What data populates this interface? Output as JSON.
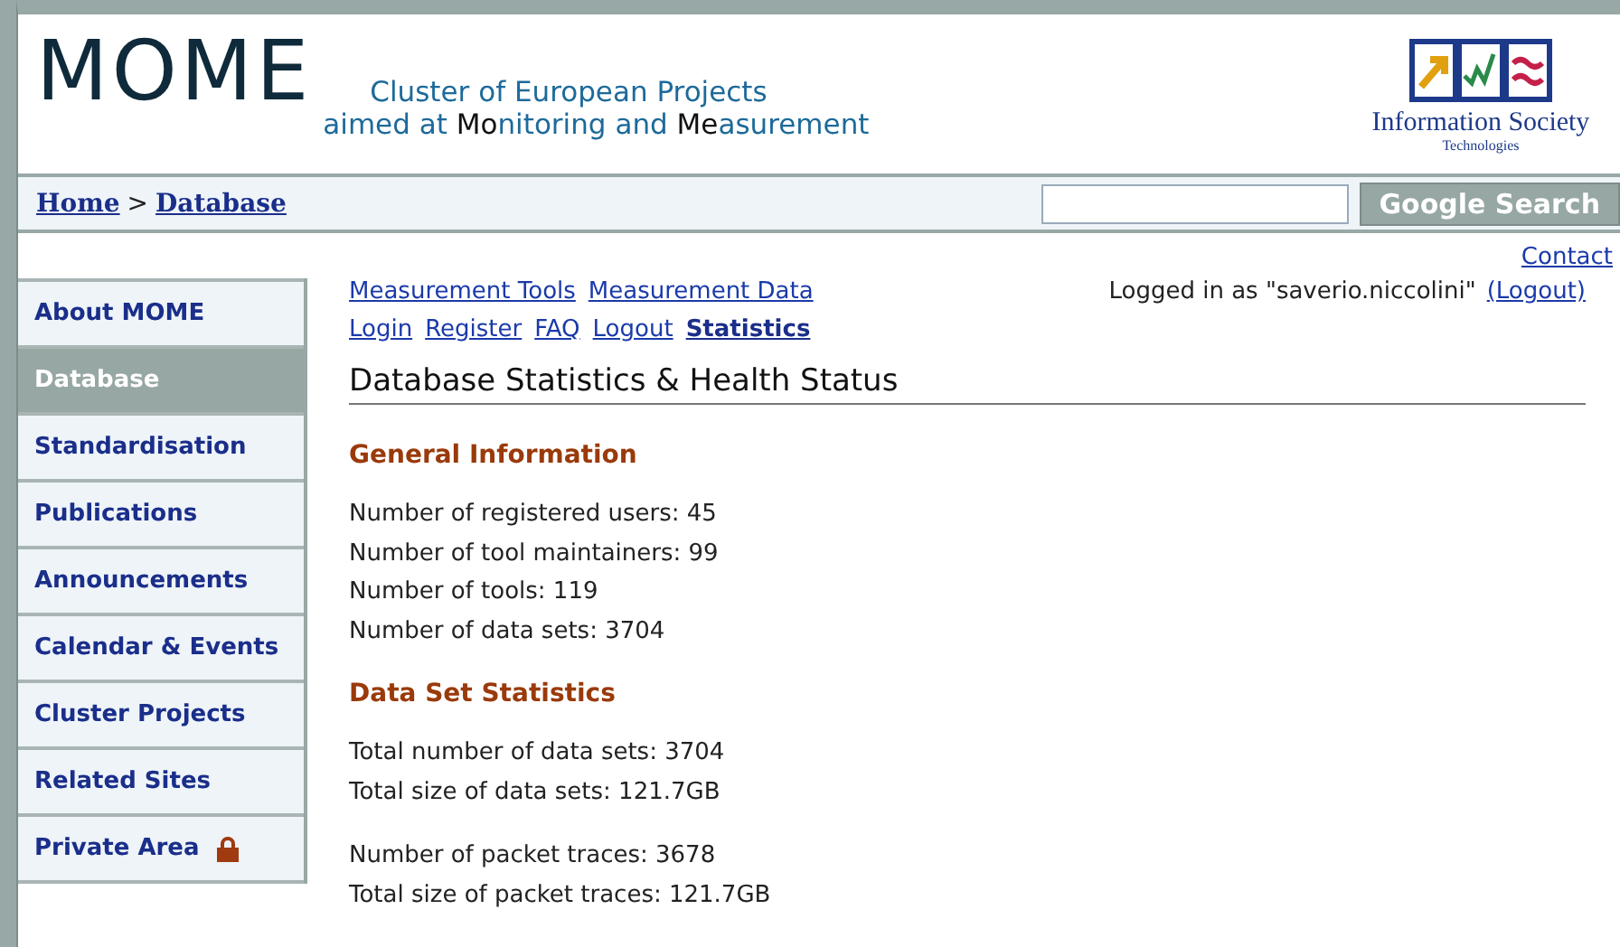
{
  "header": {
    "logo": "MOME",
    "tagline_line1": "Cluster of European Projects",
    "tagline_line2": [
      {
        "text": "aimed at ",
        "highlight": false
      },
      {
        "text": "Mo",
        "highlight": true
      },
      {
        "text": "nitoring and ",
        "highlight": false
      },
      {
        "text": "Me",
        "highlight": true
      },
      {
        "text": "asurement",
        "highlight": false
      }
    ],
    "partner_logo": {
      "title": "Information Society",
      "subtitle": "Technologies"
    }
  },
  "breadcrumb": [
    {
      "label": "Home"
    },
    {
      "label": "Database"
    }
  ],
  "breadcrumb_separator": ">",
  "search": {
    "button": "Google Search"
  },
  "contact_link": "Contact",
  "sidebar": {
    "items": [
      {
        "label": "About MOME",
        "selected": false,
        "locked": false
      },
      {
        "label": "Database",
        "selected": true,
        "locked": false
      },
      {
        "label": "Standardisation",
        "selected": false,
        "locked": false
      },
      {
        "label": "Publications",
        "selected": false,
        "locked": false
      },
      {
        "label": "Announcements",
        "selected": false,
        "locked": false
      },
      {
        "label": "Calendar & Events",
        "selected": false,
        "locked": false
      },
      {
        "label": "Cluster Projects",
        "selected": false,
        "locked": false
      },
      {
        "label": "Related Sites",
        "selected": false,
        "locked": false
      },
      {
        "label": "Private Area",
        "selected": false,
        "locked": true
      }
    ]
  },
  "menu_rows": [
    [
      {
        "label": "Measurement Tools",
        "selected": false
      },
      {
        "label": "Measurement Data",
        "selected": false
      }
    ],
    [
      {
        "label": "Login",
        "selected": false
      },
      {
        "label": "Register",
        "selected": false
      },
      {
        "label": "FAQ",
        "selected": false
      },
      {
        "label": "Logout",
        "selected": false
      },
      {
        "label": "Statistics",
        "selected": true
      }
    ]
  ],
  "login_status": {
    "text": "Logged in as \"saverio.niccolini\"",
    "logout_link": "(Logout)"
  },
  "page_title": "Database Statistics & Health Status",
  "sections": [
    {
      "heading": "General Information",
      "groups": [
        [
          "Number of registered users: 45",
          "Number of tool maintainers: 99",
          "Number of tools: 119",
          "Number of data sets: 3704"
        ]
      ]
    },
    {
      "heading": "Data Set Statistics",
      "groups": [
        [
          "Total number of data sets: 3704",
          "Total size of data sets: 121.7GB"
        ],
        [
          "Number of packet traces: 3678",
          "Total size of packet traces: 121.7GB"
        ]
      ]
    }
  ]
}
